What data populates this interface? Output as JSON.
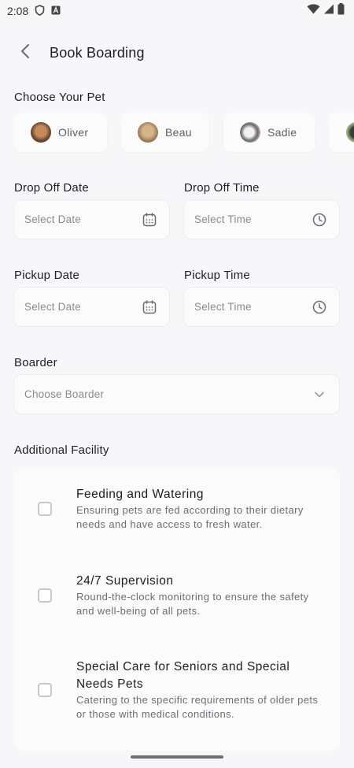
{
  "status_bar": {
    "time": "2:08",
    "icons": [
      "shield-icon",
      "font-icon",
      "wifi-icon",
      "signal-icon",
      "battery-icon"
    ]
  },
  "header": {
    "back_icon": "chevron-left-icon",
    "title": "Book Boarding"
  },
  "pets": {
    "label": "Choose Your Pet",
    "items": [
      {
        "name": "Oliver"
      },
      {
        "name": "Beau"
      },
      {
        "name": "Sadie"
      },
      {
        "name": ""
      }
    ]
  },
  "drop_off": {
    "date_label": "Drop Off Date",
    "date_placeholder": "Select Date",
    "time_label": "Drop Off Time",
    "time_placeholder": "Select Time"
  },
  "pickup": {
    "date_label": "Pickup Date",
    "date_placeholder": "Select Date",
    "time_label": "Pickup Time",
    "time_placeholder": "Select Time"
  },
  "boarder": {
    "label": "Boarder",
    "placeholder": "Choose Boarder"
  },
  "facility": {
    "label": "Additional Facility",
    "items": [
      {
        "title": "Feeding and Watering",
        "description": "Ensuring pets are fed according to their dietary needs and have access to fresh water.",
        "checked": false
      },
      {
        "title": "24/7 Supervision",
        "description": "Round-the-clock monitoring to ensure the safety and well-being of all pets.",
        "checked": false
      },
      {
        "title": "Special Care for Seniors and Special Needs Pets",
        "description": "Catering to the specific requirements of older pets or those with medical conditions.",
        "checked": false
      }
    ]
  },
  "colors": {
    "background": "#f7f7f9",
    "card": "#fbfbfc",
    "text_primary": "#1d1d23",
    "text_secondary": "#6d6d75",
    "placeholder": "#8a8a92"
  }
}
